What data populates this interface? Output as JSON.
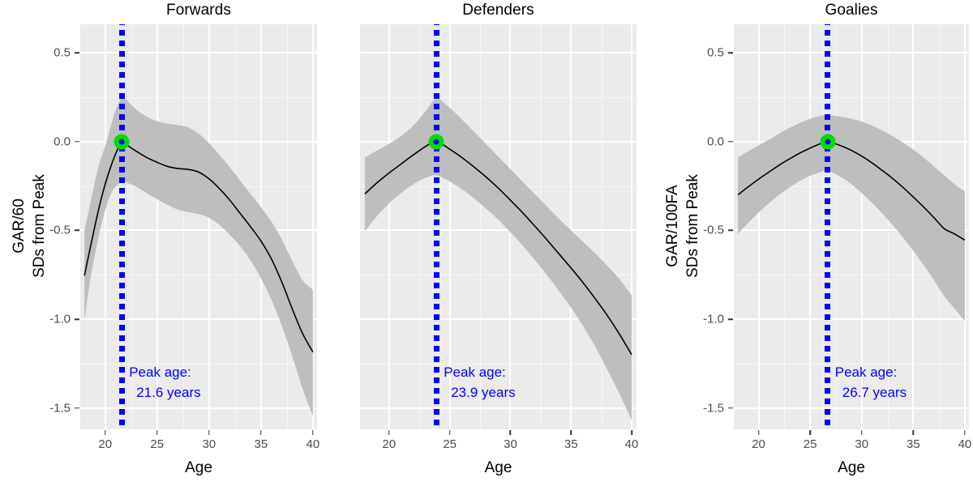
{
  "figure": {
    "background": "#FFFFFF",
    "panel_background": "#EBEBEB",
    "gridline_color": "#FFFFFF",
    "ribbon_color": "#BEBEBE",
    "line_color": "#000000",
    "peak_line_color": "#0000FF",
    "peak_point_color": "#00DD00",
    "annotation_color": "#0000FF"
  },
  "chart_data": {
    "type": "line",
    "title": "",
    "xlabel": "Age",
    "xlim": [
      17.6,
      40.4
    ],
    "ylim": [
      -1.62,
      0.66
    ],
    "xticks": [
      20,
      25,
      30,
      35,
      40
    ],
    "yticks": [
      0.5,
      0.0,
      -0.5,
      -1.0,
      -1.5
    ],
    "ytick_labels": [
      "0.5",
      "0.0",
      "-0.5",
      "-1.0",
      "-1.5"
    ],
    "xtick_labels": [
      "20",
      "25",
      "30",
      "35",
      "40"
    ],
    "grid": true,
    "legend": "none",
    "panels": [
      {
        "title": "Forwards",
        "ylabel_line1": "GAR/60",
        "ylabel_line2": "SDs from Peak",
        "peak_age": 21.6,
        "annotation_line1": "Peak age:",
        "annotation_line2": "21.6 years",
        "peak_point": {
          "x": 21.6,
          "y": 0.0
        },
        "x": [
          18.0,
          18.5,
          19.0,
          19.5,
          20.0,
          20.5,
          21.0,
          21.6,
          22.0,
          23.0,
          24.0,
          25.0,
          26.0,
          27.0,
          28.0,
          29.0,
          30.0,
          31.0,
          32.0,
          33.0,
          34.0,
          35.0,
          36.0,
          37.0,
          38.0,
          39.0,
          40.0
        ],
        "fit": [
          -0.755,
          -0.615,
          -0.478,
          -0.35,
          -0.24,
          -0.148,
          -0.07,
          0.0,
          -0.016,
          -0.055,
          -0.09,
          -0.117,
          -0.14,
          -0.152,
          -0.157,
          -0.172,
          -0.21,
          -0.265,
          -0.33,
          -0.405,
          -0.48,
          -0.56,
          -0.66,
          -0.79,
          -0.94,
          -1.08,
          -1.185
        ],
        "lower": [
          -1.01,
          -0.8,
          -0.64,
          -0.5,
          -0.385,
          -0.3,
          -0.255,
          -0.228,
          -0.23,
          -0.255,
          -0.29,
          -0.325,
          -0.357,
          -0.383,
          -0.398,
          -0.408,
          -0.43,
          -0.47,
          -0.525,
          -0.59,
          -0.67,
          -0.77,
          -0.89,
          -1.035,
          -1.205,
          -1.39,
          -1.545
        ],
        "upper": [
          -0.5,
          -0.368,
          -0.228,
          -0.11,
          -0.025,
          0.08,
          0.175,
          0.25,
          0.236,
          0.18,
          0.14,
          0.115,
          0.1,
          0.092,
          0.08,
          0.045,
          -0.01,
          -0.075,
          -0.145,
          -0.22,
          -0.295,
          -0.37,
          -0.45,
          -0.55,
          -0.67,
          -0.78,
          -0.835
        ]
      },
      {
        "title": "Defenders",
        "ylabel_line1": "",
        "ylabel_line2": "",
        "peak_age": 23.9,
        "annotation_line1": "Peak age:",
        "annotation_line2": "23.9 years",
        "peak_point": {
          "x": 23.9,
          "y": 0.0
        },
        "x": [
          18.0,
          19.0,
          20.0,
          21.0,
          22.0,
          23.0,
          23.9,
          25.0,
          26.0,
          27.0,
          28.0,
          29.0,
          30.0,
          31.0,
          32.0,
          33.0,
          34.0,
          35.0,
          36.0,
          37.0,
          38.0,
          39.0,
          40.0
        ],
        "fit": [
          -0.295,
          -0.232,
          -0.177,
          -0.126,
          -0.075,
          -0.028,
          0.0,
          -0.043,
          -0.09,
          -0.143,
          -0.2,
          -0.262,
          -0.33,
          -0.4,
          -0.475,
          -0.552,
          -0.632,
          -0.712,
          -0.795,
          -0.885,
          -0.98,
          -1.085,
          -1.2
        ],
        "lower": [
          -0.505,
          -0.42,
          -0.348,
          -0.29,
          -0.24,
          -0.205,
          -0.19,
          -0.225,
          -0.268,
          -0.32,
          -0.378,
          -0.44,
          -0.51,
          -0.585,
          -0.665,
          -0.75,
          -0.84,
          -0.935,
          -1.04,
          -1.155,
          -1.285,
          -1.42,
          -1.57
        ],
        "upper": [
          -0.09,
          -0.05,
          -0.013,
          0.032,
          0.09,
          0.17,
          0.24,
          0.19,
          0.125,
          0.055,
          -0.015,
          -0.085,
          -0.155,
          -0.225,
          -0.295,
          -0.365,
          -0.435,
          -0.5,
          -0.565,
          -0.63,
          -0.7,
          -0.775,
          -0.865
        ]
      },
      {
        "title": "Goalies",
        "ylabel_line1": "GAR/100FA",
        "ylabel_line2": "SDs from Peak",
        "peak_age": 26.7,
        "annotation_line1": "Peak age:",
        "annotation_line2": "26.7 years",
        "peak_point": {
          "x": 26.7,
          "y": 0.0
        },
        "x": [
          18.0,
          19.0,
          20.0,
          21.0,
          22.0,
          23.0,
          24.0,
          25.0,
          26.0,
          26.7,
          28.0,
          29.0,
          30.0,
          31.0,
          32.0,
          33.0,
          34.0,
          35.0,
          36.0,
          37.0,
          38.0,
          39.0,
          40.0
        ],
        "fit": [
          -0.3,
          -0.255,
          -0.212,
          -0.172,
          -0.133,
          -0.098,
          -0.065,
          -0.037,
          -0.012,
          0.0,
          -0.024,
          -0.05,
          -0.082,
          -0.12,
          -0.163,
          -0.208,
          -0.258,
          -0.312,
          -0.368,
          -0.428,
          -0.49,
          -0.52,
          -0.555
        ],
        "lower": [
          -0.52,
          -0.458,
          -0.4,
          -0.348,
          -0.3,
          -0.258,
          -0.222,
          -0.193,
          -0.172,
          -0.165,
          -0.2,
          -0.24,
          -0.29,
          -0.345,
          -0.405,
          -0.47,
          -0.54,
          -0.615,
          -0.695,
          -0.78,
          -0.87,
          -0.94,
          -1.01
        ],
        "upper": [
          -0.09,
          -0.055,
          -0.022,
          0.01,
          0.045,
          0.077,
          0.105,
          0.128,
          0.145,
          0.15,
          0.14,
          0.128,
          0.112,
          0.09,
          0.062,
          0.03,
          -0.005,
          -0.045,
          -0.09,
          -0.14,
          -0.19,
          -0.24,
          -0.28
        ]
      }
    ]
  }
}
